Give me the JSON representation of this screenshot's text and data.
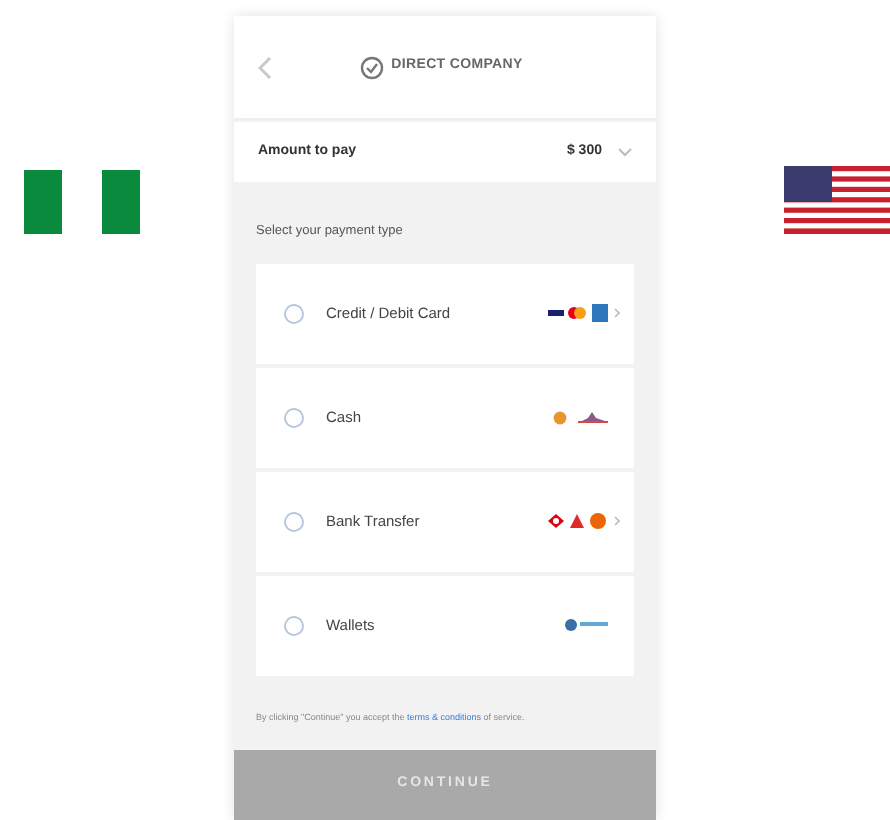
{
  "header": {
    "title": "DIRECT COMPANY"
  },
  "amount": {
    "label": "Amount to pay",
    "value": "$ 300"
  },
  "section_title": "Select your payment type",
  "methods": [
    {
      "label": "Credit / Debit Card",
      "kind": "card",
      "selected": false,
      "expandable": true
    },
    {
      "label": "Cash",
      "kind": "cash",
      "selected": false,
      "expandable": false
    },
    {
      "label": "Bank Transfer",
      "kind": "bank",
      "selected": false,
      "expandable": true
    },
    {
      "label": "Wallets",
      "kind": "wallet",
      "selected": false,
      "expandable": false
    }
  ],
  "terms": {
    "before": "By clicking \"Continue\" you accept the ",
    "link": "terms & conditions",
    "after": " of service."
  },
  "continue_button": {
    "label": "CONTINUE",
    "disabled": true
  }
}
